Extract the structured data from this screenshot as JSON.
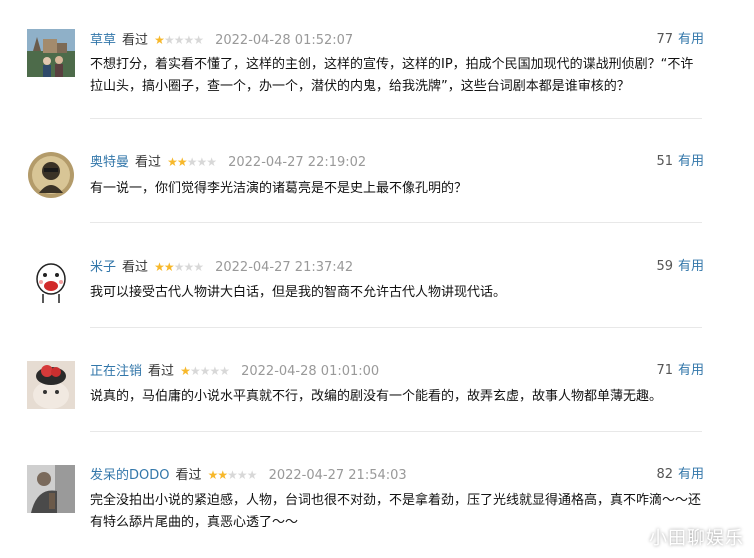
{
  "reviews": [
    {
      "user": "草草",
      "watched": "看过",
      "rating": 1,
      "time": "2022-04-28 01:52:07",
      "votes": "77",
      "useful": "有用",
      "content": "不想打分，着实看不懂了，这样的主创，这样的宣传，这样的IP，拍成个民国加现代的谍战刑侦剧？“不许拉山头，搞小圈子，查一个，办一个，潜伏的内鬼，给我洗牌”，这些台词剧本都是谁审核的？"
    },
    {
      "user": "奥特曼",
      "watched": "看过",
      "rating": 2,
      "time": "2022-04-27 22:19:02",
      "votes": "51",
      "useful": "有用",
      "content": "有一说一，你们觉得李光洁演的诸葛亮是不是史上最不像孔明的？"
    },
    {
      "user": "米子",
      "watched": "看过",
      "rating": 2,
      "time": "2022-04-27 21:37:42",
      "votes": "59",
      "useful": "有用",
      "content": "我可以接受古代人物讲大白话，但是我的智商不允许古代人物讲现代话。"
    },
    {
      "user": "正在注销",
      "watched": "看过",
      "rating": 1,
      "time": "2022-04-28 01:01:00",
      "votes": "71",
      "useful": "有用",
      "content": "说真的，马伯庸的小说水平真就不行，改编的剧没有一个能看的，故弄玄虚，故事人物都单薄无趣。"
    },
    {
      "user": "发呆的DODO",
      "watched": "看过",
      "rating": 2,
      "time": "2022-04-27 21:54:03",
      "votes": "82",
      "useful": "有用",
      "content": "完全没拍出小说的紧迫感，人物，台词也很不对劲，不是拿着劲，压了光线就显得通格高，真不咋滴～～还有特么舔片尾曲的，真恶心透了～～"
    }
  ],
  "watermark": "小田聊娱乐",
  "colors": {
    "username": "#3377aa",
    "star_on": "#f7b82b",
    "star_off": "#d8d8d8",
    "time": "#999999"
  }
}
